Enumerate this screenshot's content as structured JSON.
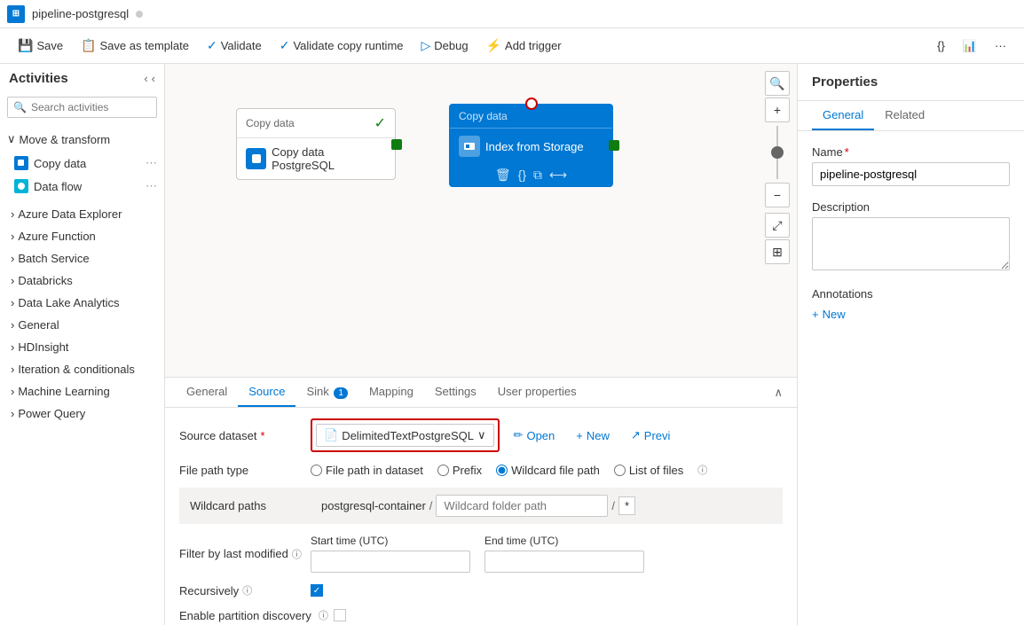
{
  "titleBar": {
    "icon": "⊞",
    "title": "pipeline-postgresql",
    "dot": ""
  },
  "toolbar": {
    "save": "Save",
    "saveTemplate": "Save as template",
    "validate": "Validate",
    "validateCopyRuntime": "Validate copy runtime",
    "debug": "Debug",
    "addTrigger": "Add trigger"
  },
  "sidebar": {
    "title": "Activities",
    "searchPlaceholder": "Search activities",
    "sections": [
      {
        "label": "Move & transform",
        "items": [
          {
            "label": "Copy data"
          },
          {
            "label": "Data flow"
          }
        ]
      },
      {
        "label": "Azure Data Explorer"
      },
      {
        "label": "Azure Function"
      },
      {
        "label": "Batch Service"
      },
      {
        "label": "Databricks"
      },
      {
        "label": "Data Lake Analytics"
      },
      {
        "label": "General"
      },
      {
        "label": "HDInsight"
      },
      {
        "label": "Iteration & conditionals"
      },
      {
        "label": "Machine Learning"
      },
      {
        "label": "Power Query"
      }
    ]
  },
  "canvas": {
    "nodes": [
      {
        "id": "copy-postgresql",
        "label": "Copy data",
        "name": "Copy data PostgreSQL",
        "type": "copy",
        "status": "success"
      },
      {
        "id": "index-storage",
        "label": "Copy data",
        "name": "Index from Storage",
        "type": "copy",
        "active": true
      }
    ]
  },
  "bottomPanel": {
    "tabs": [
      {
        "label": "General",
        "active": false
      },
      {
        "label": "Source",
        "active": true
      },
      {
        "label": "Sink",
        "badge": "1",
        "active": false
      },
      {
        "label": "Mapping",
        "active": false
      },
      {
        "label": "Settings",
        "active": false
      },
      {
        "label": "User properties",
        "active": false
      }
    ],
    "source": {
      "datasetLabel": "Source dataset",
      "datasetValue": "DelimitedTextPostgreSQL",
      "openBtn": "Open",
      "newBtn": "New",
      "previewBtn": "Previ",
      "filePathTypeLabel": "File path type",
      "filePathOptions": [
        {
          "label": "File path in dataset",
          "value": "file-path"
        },
        {
          "label": "Prefix",
          "value": "prefix"
        },
        {
          "label": "Wildcard file path",
          "value": "wildcard",
          "checked": true
        },
        {
          "label": "List of files",
          "value": "list"
        }
      ],
      "wildcardPathsLabel": "Wildcard paths",
      "containerValue": "postgresql-container",
      "folderPlaceholder": "Wildcard folder path",
      "asterisk": "*",
      "filterLabel": "Filter by last modified",
      "startTimeLabel": "Start time (UTC)",
      "endTimeLabel": "End time (UTC)",
      "recursivelyLabel": "Recursively",
      "enablePartitionLabel": "Enable partition discovery"
    }
  },
  "properties": {
    "title": "Properties",
    "tabs": [
      {
        "label": "General",
        "active": true
      },
      {
        "label": "Related",
        "active": false
      }
    ],
    "nameLabel": "Name",
    "nameRequired": "*",
    "nameValue": "pipeline-postgresql",
    "descriptionLabel": "Description",
    "descriptionValue": "",
    "annotationsLabel": "Annotations",
    "addNewLabel": "New"
  }
}
